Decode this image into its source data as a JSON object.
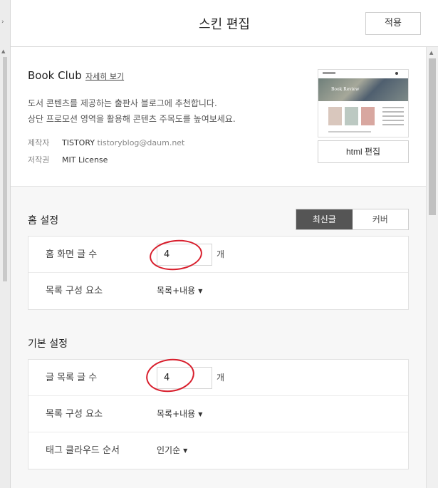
{
  "header": {
    "title": "스킨 편집",
    "apply_label": "적용"
  },
  "skin": {
    "name": "Book Club",
    "detail_link": "자세히 보기",
    "description_lines": [
      "도서 콘텐츠를 제공하는 출판사 블로그에 추천합니다.",
      "상단 프로모션 영역을 활용해 콘텐츠 주목도를 높여보세요."
    ],
    "author_label": "제작자",
    "author_name": "TISTORY",
    "author_email": "tistoryblog@daum.net",
    "license_label": "저작권",
    "license_value": "MIT License",
    "thumbnail_text": "Book Review",
    "html_edit_label": "html 편집"
  },
  "home_settings": {
    "title": "홈 설정",
    "tabs": [
      {
        "label": "최신글",
        "active": true
      },
      {
        "label": "커버",
        "active": false
      }
    ],
    "rows": [
      {
        "label": "홈 화면 글 수",
        "value": "4",
        "unit": "개"
      },
      {
        "label": "목록 구성 요소",
        "value": "목록+내용"
      }
    ]
  },
  "basic_settings": {
    "title": "기본 설정",
    "rows": [
      {
        "label": "글 목록 글 수",
        "value": "4",
        "unit": "개"
      },
      {
        "label": "목록 구성 요소",
        "value": "목록+내용"
      },
      {
        "label": "태그 클라우드 순서",
        "value": "인기순"
      }
    ]
  },
  "colors": {
    "accent_dark": "#555555",
    "annotation_red": "#d81e2c"
  }
}
